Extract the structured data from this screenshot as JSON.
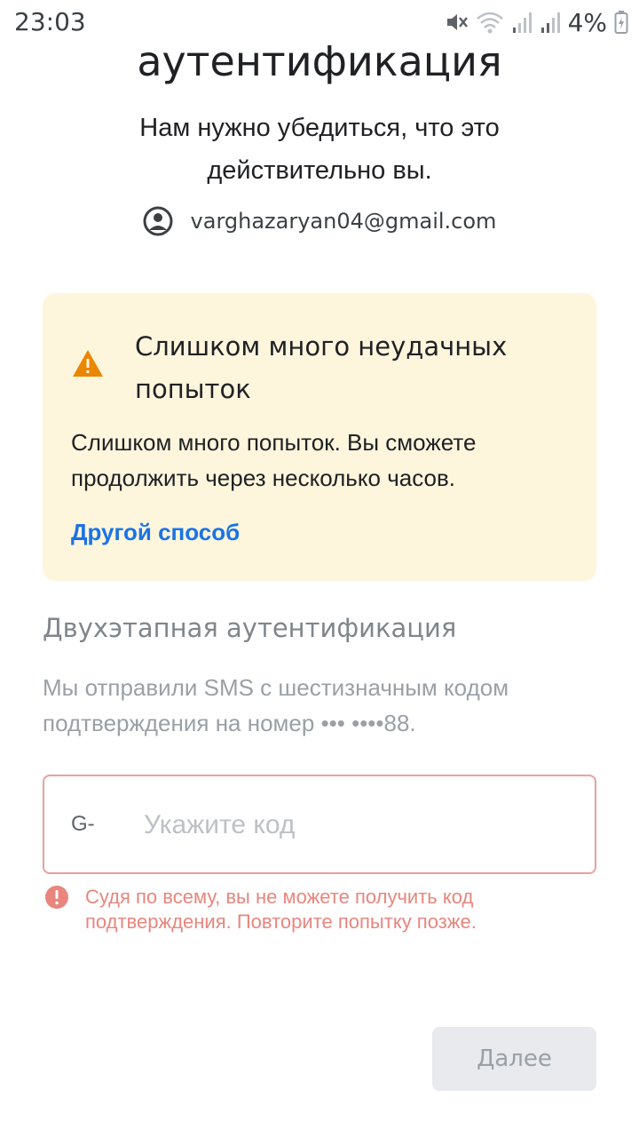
{
  "status_bar": {
    "time": "23:03",
    "battery_percent": "4%"
  },
  "header": {
    "title": "аутентификация",
    "subtitle": "Нам нужно убедиться, что это действительно вы.",
    "account_email": "varghazaryan04@gmail.com"
  },
  "warning": {
    "title": "Слишком много неудачных попыток",
    "text": "Слишком много попыток. Вы сможете продолжить через несколько часов.",
    "link": "Другой способ",
    "color": "#fdf6dd",
    "icon": "warning-triangle-icon"
  },
  "two_step": {
    "title": "Двухэтапная аутентификация",
    "description": "Мы отправили SMS с шестизначным кодом подтверждения на номер ••• ••••88.",
    "code_prefix": "G-",
    "code_placeholder": "Укажите код",
    "code_value": "",
    "error_text": "Судя по всему, вы не можете получить код подтверждения. Повторите попытку позже.",
    "error_color": "#e8867e"
  },
  "actions": {
    "next_label": "Далее"
  },
  "accent": "#1a73e8"
}
